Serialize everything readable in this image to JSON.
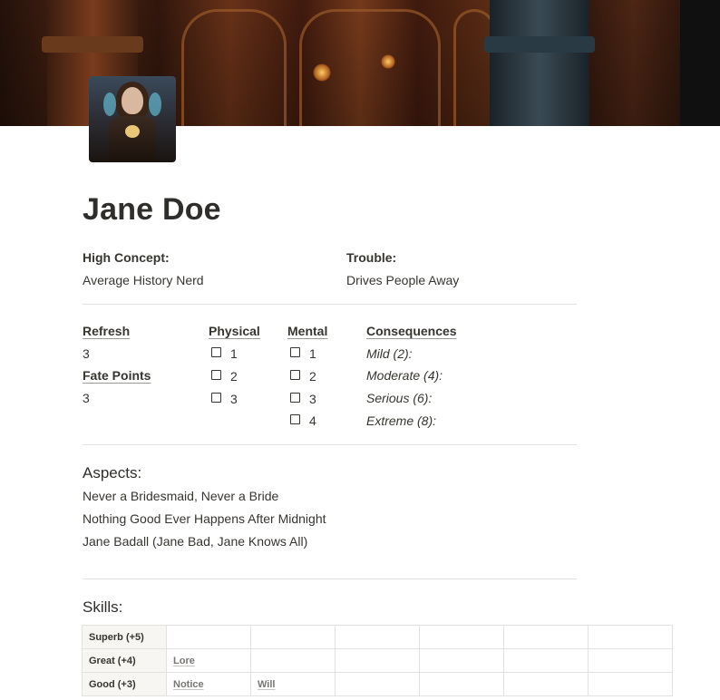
{
  "page": {
    "title": "Jane Doe"
  },
  "identity": {
    "high_concept_label": "High Concept:",
    "high_concept_value": "Average History Nerd",
    "trouble_label": "Trouble:",
    "trouble_value": "Drives People Away"
  },
  "stats": {
    "refresh_label": "Refresh",
    "refresh_value": "3",
    "fate_points_label": "Fate Points",
    "fate_points_value": "3"
  },
  "stress": {
    "physical_label": "Physical",
    "physical_boxes": [
      "1",
      "2",
      "3"
    ],
    "mental_label": "Mental",
    "mental_boxes": [
      "1",
      "2",
      "3",
      "4"
    ]
  },
  "consequences": {
    "label": "Consequences",
    "items": [
      "Mild (2):",
      "Moderate (4):",
      "Serious (6):",
      "Extreme (8):"
    ]
  },
  "aspects": {
    "heading": "Aspects:",
    "items": [
      "Never a Bridesmaid, Never a Bride",
      "Nothing Good Ever Happens After Midnight",
      "Jane Badall (Jane Bad, Jane Knows All)"
    ]
  },
  "skills": {
    "heading": "Skills:",
    "rows": [
      {
        "label": "Superb (+5)",
        "cells": [
          "",
          "",
          "",
          "",
          "",
          ""
        ]
      },
      {
        "label": "Great (+4)",
        "cells": [
          "Lore",
          "",
          "",
          "",
          "",
          ""
        ]
      },
      {
        "label": "Good (+3)",
        "cells": [
          "Notice",
          "Will",
          "",
          "",
          "",
          ""
        ]
      }
    ]
  }
}
